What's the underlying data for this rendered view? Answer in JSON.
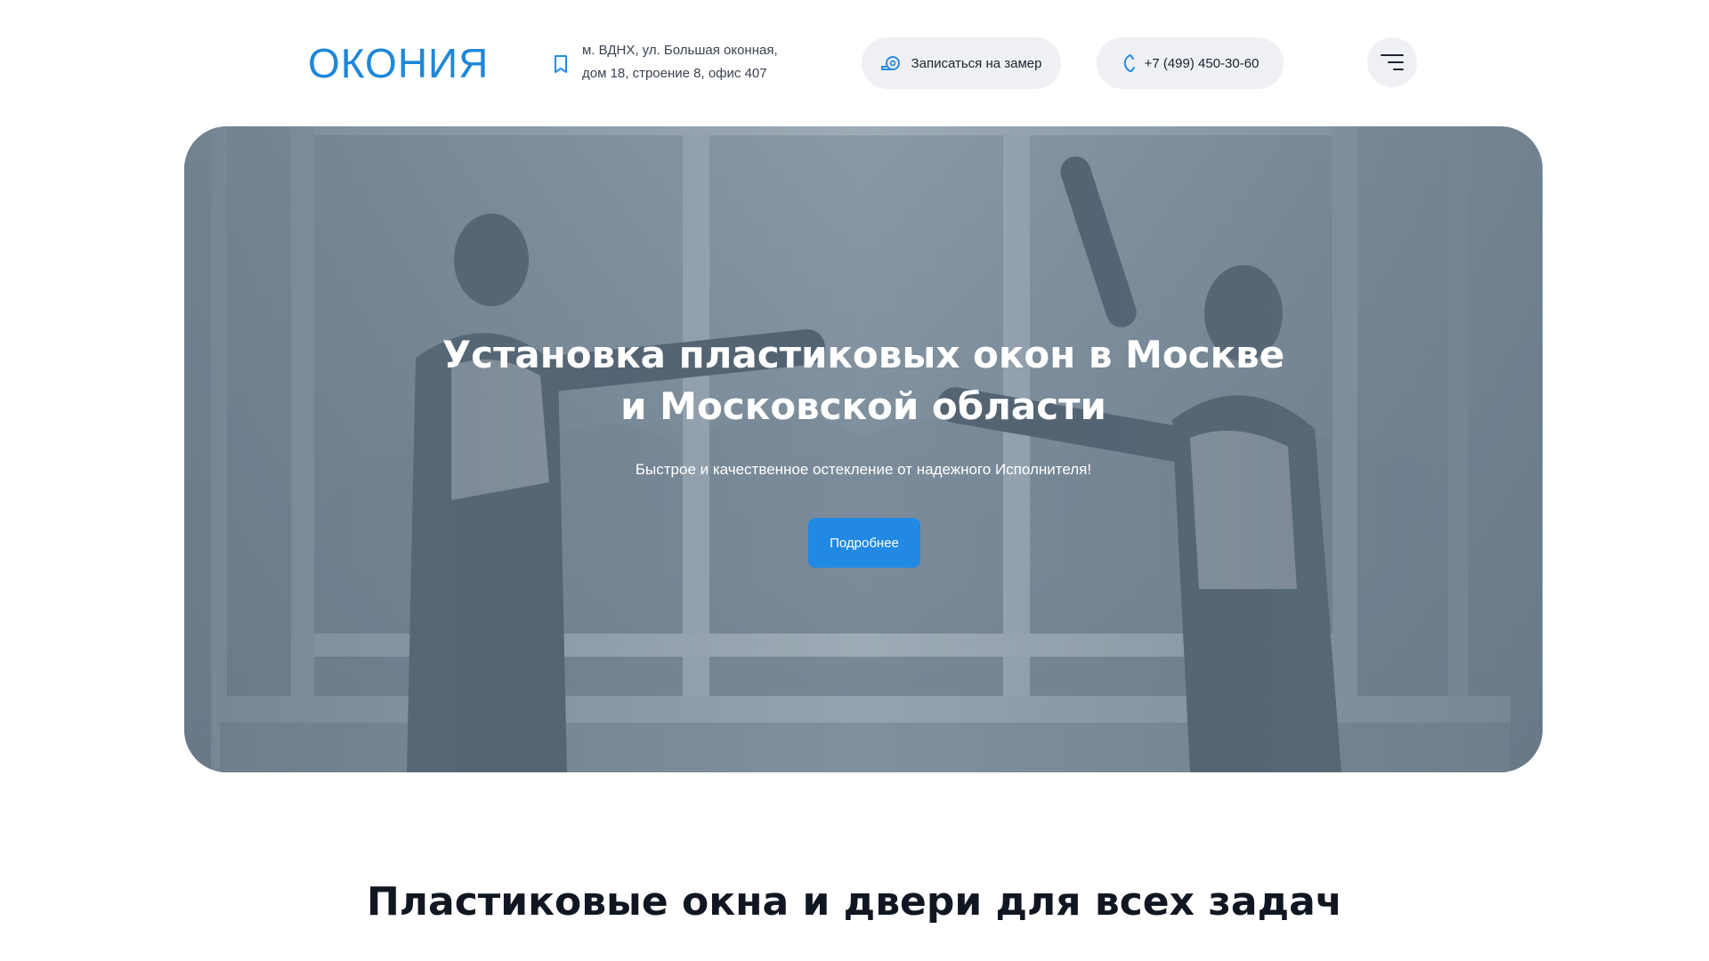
{
  "header": {
    "logo": "ОКОНИЯ",
    "address_line1": "м. ВДНХ, ул. Большая оконная,",
    "address_line2": "дом 18, строение 8, офис 407",
    "measure_label": "Записаться на замер",
    "phone_label": "+7 (499) 450-30-60"
  },
  "hero": {
    "title_line1": "Установка пластиковых окон в Москве",
    "title_line2": "и Московской области",
    "subtitle": "Быстрое и качественное остекление от надежного Исполнителя!",
    "button_label": "Подробнее"
  },
  "section": {
    "title": "Пластиковые окна и двери для всех задач"
  },
  "colors": {
    "brand": "#1f87d8",
    "accent_button": "#2189e3",
    "pill_bg": "#eef0f3",
    "hero_overlay": "#6f7f8e"
  },
  "icons": {
    "address": "map-pin-icon",
    "measure": "tape-measure-icon",
    "phone": "phone-icon",
    "menu": "hamburger-menu-icon"
  }
}
